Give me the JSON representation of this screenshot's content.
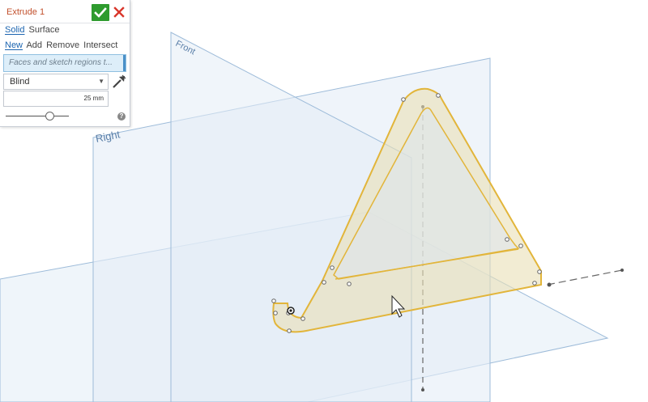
{
  "dialog": {
    "title": "Extrude 1",
    "type_tabs": [
      {
        "label": "Solid",
        "active": true
      },
      {
        "label": "Surface",
        "active": false
      }
    ],
    "operation_tabs": [
      {
        "label": "New",
        "active": true
      },
      {
        "label": "Add",
        "active": false
      },
      {
        "label": "Remove",
        "active": false
      },
      {
        "label": "Intersect",
        "active": false
      }
    ],
    "query_placeholder": "Faces and sketch regions t...",
    "end_type": "Blind",
    "depth": "25 mm",
    "slider_value": 0.68,
    "ok_icon": "checkmark-icon",
    "cancel_icon": "close-icon",
    "flip_icon": "flip-direction-icon",
    "help_icon": "help-icon"
  },
  "viewport": {
    "planes": {
      "front": "Front",
      "right": "Right"
    }
  },
  "colors": {
    "ok_green": "#2e9b2e",
    "cancel_red": "#d9362b",
    "title_orange": "#c2512d",
    "active_blue": "#1b64b0",
    "plane_blue": "#8fb3d6",
    "sketch_yellow": "#e2b53a"
  }
}
